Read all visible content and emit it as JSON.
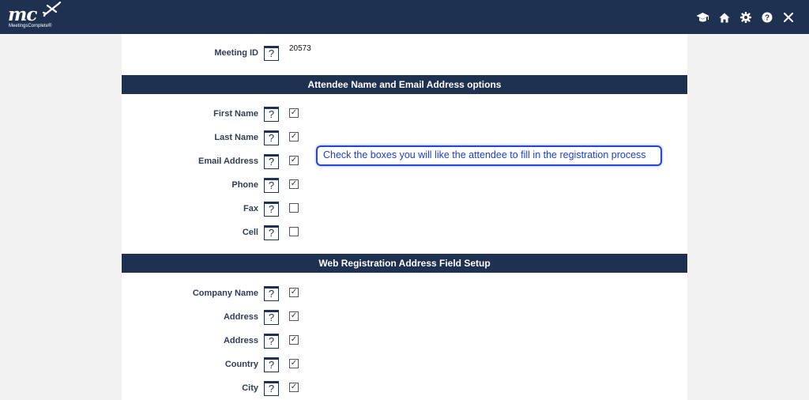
{
  "header": {
    "logo_text": "mc",
    "logo_tagline": "MeetingsComplete®",
    "icons": [
      "graduation-cap-icon",
      "home-icon",
      "gear-icon",
      "help-icon",
      "close-icon"
    ],
    "background_color": "#1f3151"
  },
  "meeting": {
    "label": "Meeting ID",
    "help": "?",
    "value": "20573"
  },
  "sections": [
    {
      "title": "Attendee Name and Email Address options",
      "fields": [
        {
          "label": "First Name",
          "help": "?",
          "checked": true
        },
        {
          "label": "Last Name",
          "help": "?",
          "checked": true
        },
        {
          "label": "Email Address",
          "help": "?",
          "checked": true
        },
        {
          "label": "Phone",
          "help": "?",
          "checked": true
        },
        {
          "label": "Fax",
          "help": "?",
          "checked": false
        },
        {
          "label": "Cell",
          "help": "?",
          "checked": false
        }
      ]
    },
    {
      "title": "Web Registration Address Field Setup",
      "fields": [
        {
          "label": "Company Name",
          "help": "?",
          "checked": true
        },
        {
          "label": "Address",
          "help": "?",
          "checked": true
        },
        {
          "label": "Address",
          "help": "?",
          "checked": true
        },
        {
          "label": "Country",
          "help": "?",
          "checked": true
        },
        {
          "label": "City",
          "help": "?",
          "checked": true
        }
      ]
    }
  ],
  "callout": {
    "text": "Check the boxes you will like the attendee to fill in the registration process",
    "border_color": "#2346d6"
  }
}
